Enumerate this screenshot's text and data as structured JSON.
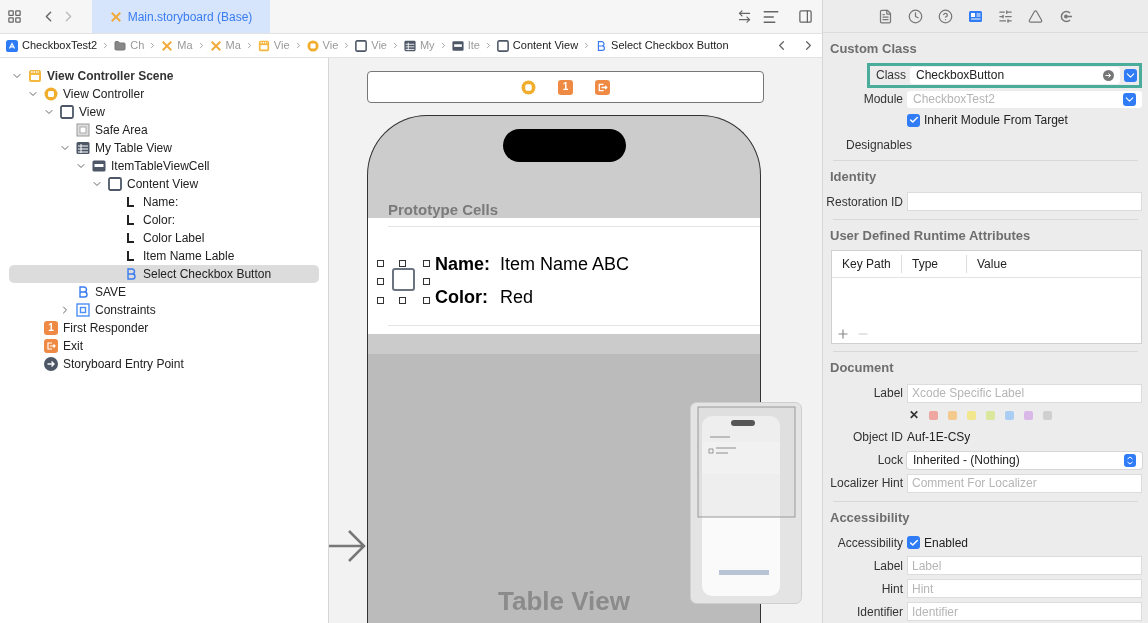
{
  "editor_tab": {
    "label": "Main.storyboard (Base)",
    "selected": true
  },
  "breadcrumbs": [
    {
      "label": "CheckboxTest2",
      "kind": "app"
    },
    {
      "label": "Ch",
      "kind": "folder"
    },
    {
      "label": "Ma",
      "kind": "storyboard"
    },
    {
      "label": "Ma",
      "kind": "storyboard"
    },
    {
      "label": "Vie",
      "kind": "scene"
    },
    {
      "label": "Vie",
      "kind": "controller"
    },
    {
      "label": "Vie",
      "kind": "view"
    },
    {
      "label": "My",
      "kind": "table"
    },
    {
      "label": "Ite",
      "kind": "cell"
    },
    {
      "label": "Content View",
      "kind": "view"
    },
    {
      "label": "Select Checkbox Button",
      "kind": "button"
    }
  ],
  "outline": [
    {
      "label": "View Controller Scene",
      "kind": "scene",
      "expanded": true,
      "selected": false,
      "children": [
        {
          "label": "View Controller",
          "kind": "controller",
          "expanded": true,
          "selected": false,
          "children": [
            {
              "label": "View",
              "kind": "view",
              "expanded": true,
              "selected": false,
              "children": [
                {
                  "label": "Safe Area",
                  "kind": "safe",
                  "selected": false
                },
                {
                  "label": "My Table View",
                  "kind": "table",
                  "expanded": true,
                  "selected": false,
                  "children": [
                    {
                      "label": "ItemTableViewCell",
                      "kind": "cell",
                      "expanded": true,
                      "selected": false,
                      "children": [
                        {
                          "label": "Content View",
                          "kind": "view",
                          "expanded": true,
                          "selected": false,
                          "children": [
                            {
                              "label": "Name:",
                              "kind": "label",
                              "selected": false
                            },
                            {
                              "label": "Color:",
                              "kind": "label",
                              "selected": false
                            },
                            {
                              "label": "Color Label",
                              "kind": "label",
                              "selected": false
                            },
                            {
                              "label": "Item Name Lable",
                              "kind": "label",
                              "selected": false
                            },
                            {
                              "label": "Select Checkbox Button",
                              "kind": "button",
                              "selected": true
                            }
                          ]
                        }
                      ]
                    }
                  ]
                },
                {
                  "label": "SAVE",
                  "kind": "button",
                  "selected": false
                },
                {
                  "label": "Constraints",
                  "kind": "constraints",
                  "expanded": false,
                  "selected": false
                }
              ]
            }
          ]
        },
        {
          "label": "First Responder",
          "kind": "responder",
          "badge": "1",
          "selected": false
        },
        {
          "label": "Exit",
          "kind": "exit",
          "selected": false
        },
        {
          "label": "Storyboard Entry Point",
          "kind": "entry",
          "selected": false
        }
      ]
    }
  ],
  "canvas": {
    "dock": [
      {
        "kind": "controller"
      },
      {
        "kind": "responder",
        "badge": "1"
      },
      {
        "kind": "exit"
      }
    ],
    "section_header": "Prototype Cells",
    "cell": {
      "checkbox_checked": false,
      "name_label": "Name:",
      "name_value": "Item Name ABC",
      "color_label": "Color:",
      "color_value": "Red"
    },
    "table_title": "Table View"
  },
  "inspector": {
    "tabs": [
      {
        "kind": "file",
        "selected": false
      },
      {
        "kind": "history",
        "selected": false
      },
      {
        "kind": "help",
        "selected": false
      },
      {
        "kind": "identity",
        "selected": true
      },
      {
        "kind": "attributes",
        "selected": false
      },
      {
        "kind": "size",
        "selected": false
      },
      {
        "kind": "connections",
        "selected": false
      }
    ],
    "custom_class": {
      "title": "Custom Class",
      "class_label": "Class",
      "class_value": "CheckboxButton",
      "module_label": "Module",
      "module_placeholder": "CheckboxTest2",
      "inherit_label": "Inherit Module From Target",
      "inherit_checked": true,
      "designables_label": "Designables"
    },
    "identity": {
      "title": "Identity",
      "restoration_label": "Restoration ID"
    },
    "runtime_attributes": {
      "title": "User Defined Runtime Attributes",
      "columns": [
        "Key Path",
        "Type",
        "Value"
      ]
    },
    "document": {
      "title": "Document",
      "label_label": "Label",
      "label_placeholder": "Xcode Specific Label",
      "clear_mark": "✕",
      "colors": [
        {
          "color": "#f0a6a0"
        },
        {
          "color": "#f3c98e"
        },
        {
          "color": "#f3e78e"
        },
        {
          "color": "#d9e89c"
        },
        {
          "color": "#a9cdf3"
        },
        {
          "color": "#d9b8e8"
        },
        {
          "color": "#cfcfcf"
        }
      ],
      "object_id_label": "Object ID",
      "object_id": "Auf-1E-CSy",
      "lock_label": "Lock",
      "lock_value": "Inherited - (Nothing)",
      "hint_label": "Localizer Hint",
      "hint_placeholder": "Comment For Localizer"
    },
    "accessibility": {
      "title": "Accessibility",
      "enabled_label": "Accessibility",
      "enabled_text": "Enabled",
      "enabled_checked": true,
      "fields": [
        {
          "label": "Label",
          "placeholder": "Label"
        },
        {
          "label": "Hint",
          "placeholder": "Hint"
        },
        {
          "label": "Identifier",
          "placeholder": "Identifier"
        }
      ]
    }
  }
}
